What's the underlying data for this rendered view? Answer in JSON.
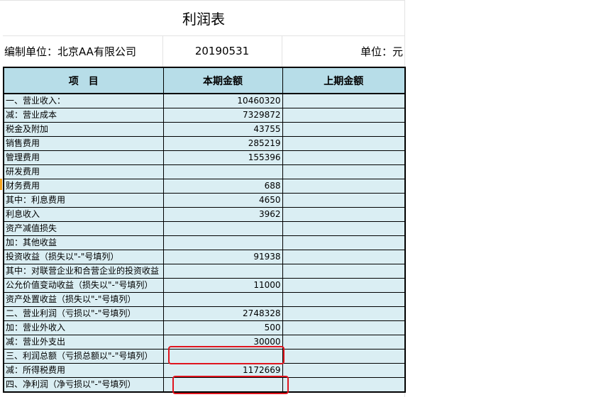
{
  "title": "利润表",
  "info": {
    "unit": "编制单位：北京AA有限公司",
    "date": "20190531",
    "currency": "单位：元"
  },
  "headers": {
    "item": "项　目",
    "current": "本期金额",
    "previous": "上期金额"
  },
  "rows": [
    {
      "item": "一、营业收入：",
      "current": "10460320",
      "previous": ""
    },
    {
      "item": "减：营业成本",
      "current": "7329872",
      "previous": ""
    },
    {
      "item": "税金及附加",
      "current": "43755",
      "previous": ""
    },
    {
      "item": "销售费用",
      "current": "285219",
      "previous": ""
    },
    {
      "item": "管理费用",
      "current": "155396",
      "previous": ""
    },
    {
      "item": "研发费用",
      "current": "",
      "previous": ""
    },
    {
      "item": "财务费用",
      "current": "688",
      "previous": ""
    },
    {
      "item": "其中：利息费用",
      "current": "4650",
      "previous": ""
    },
    {
      "item": "利息收入",
      "current": "3962",
      "previous": ""
    },
    {
      "item": "资产减值损失",
      "current": "",
      "previous": ""
    },
    {
      "item": "加：其他收益",
      "current": "",
      "previous": ""
    },
    {
      "item": "投资收益（损失以\"-\"号填列）",
      "current": "91938",
      "previous": ""
    },
    {
      "item": "其中：对联营企业和合营企业的投资收益",
      "current": "",
      "previous": ""
    },
    {
      "item": "公允价值变动收益（损失以\"-\"号填列）",
      "current": "11000",
      "previous": ""
    },
    {
      "item": "资产处置收益（损失以\"-\"号填列）",
      "current": "",
      "previous": ""
    },
    {
      "item": "二、营业利润（亏损以\"-\"号填列）",
      "current": "2748328",
      "previous": ""
    },
    {
      "item": "加：营业外收入",
      "current": "500",
      "previous": ""
    },
    {
      "item": "减：营业外支出",
      "current": "30000",
      "previous": ""
    },
    {
      "item": "三、利润总额（亏损总额以\"-\"号填列）",
      "current": "",
      "previous": ""
    },
    {
      "item": "减：所得税费用",
      "current": "1172669",
      "previous": ""
    },
    {
      "item": "四、净利润（净亏损以\"-\"号填列）",
      "current": "",
      "previous": ""
    }
  ],
  "colors": {
    "header_fill": "#b7dde8",
    "row_fill": "#daeef3",
    "highlight": "#e0141e"
  }
}
